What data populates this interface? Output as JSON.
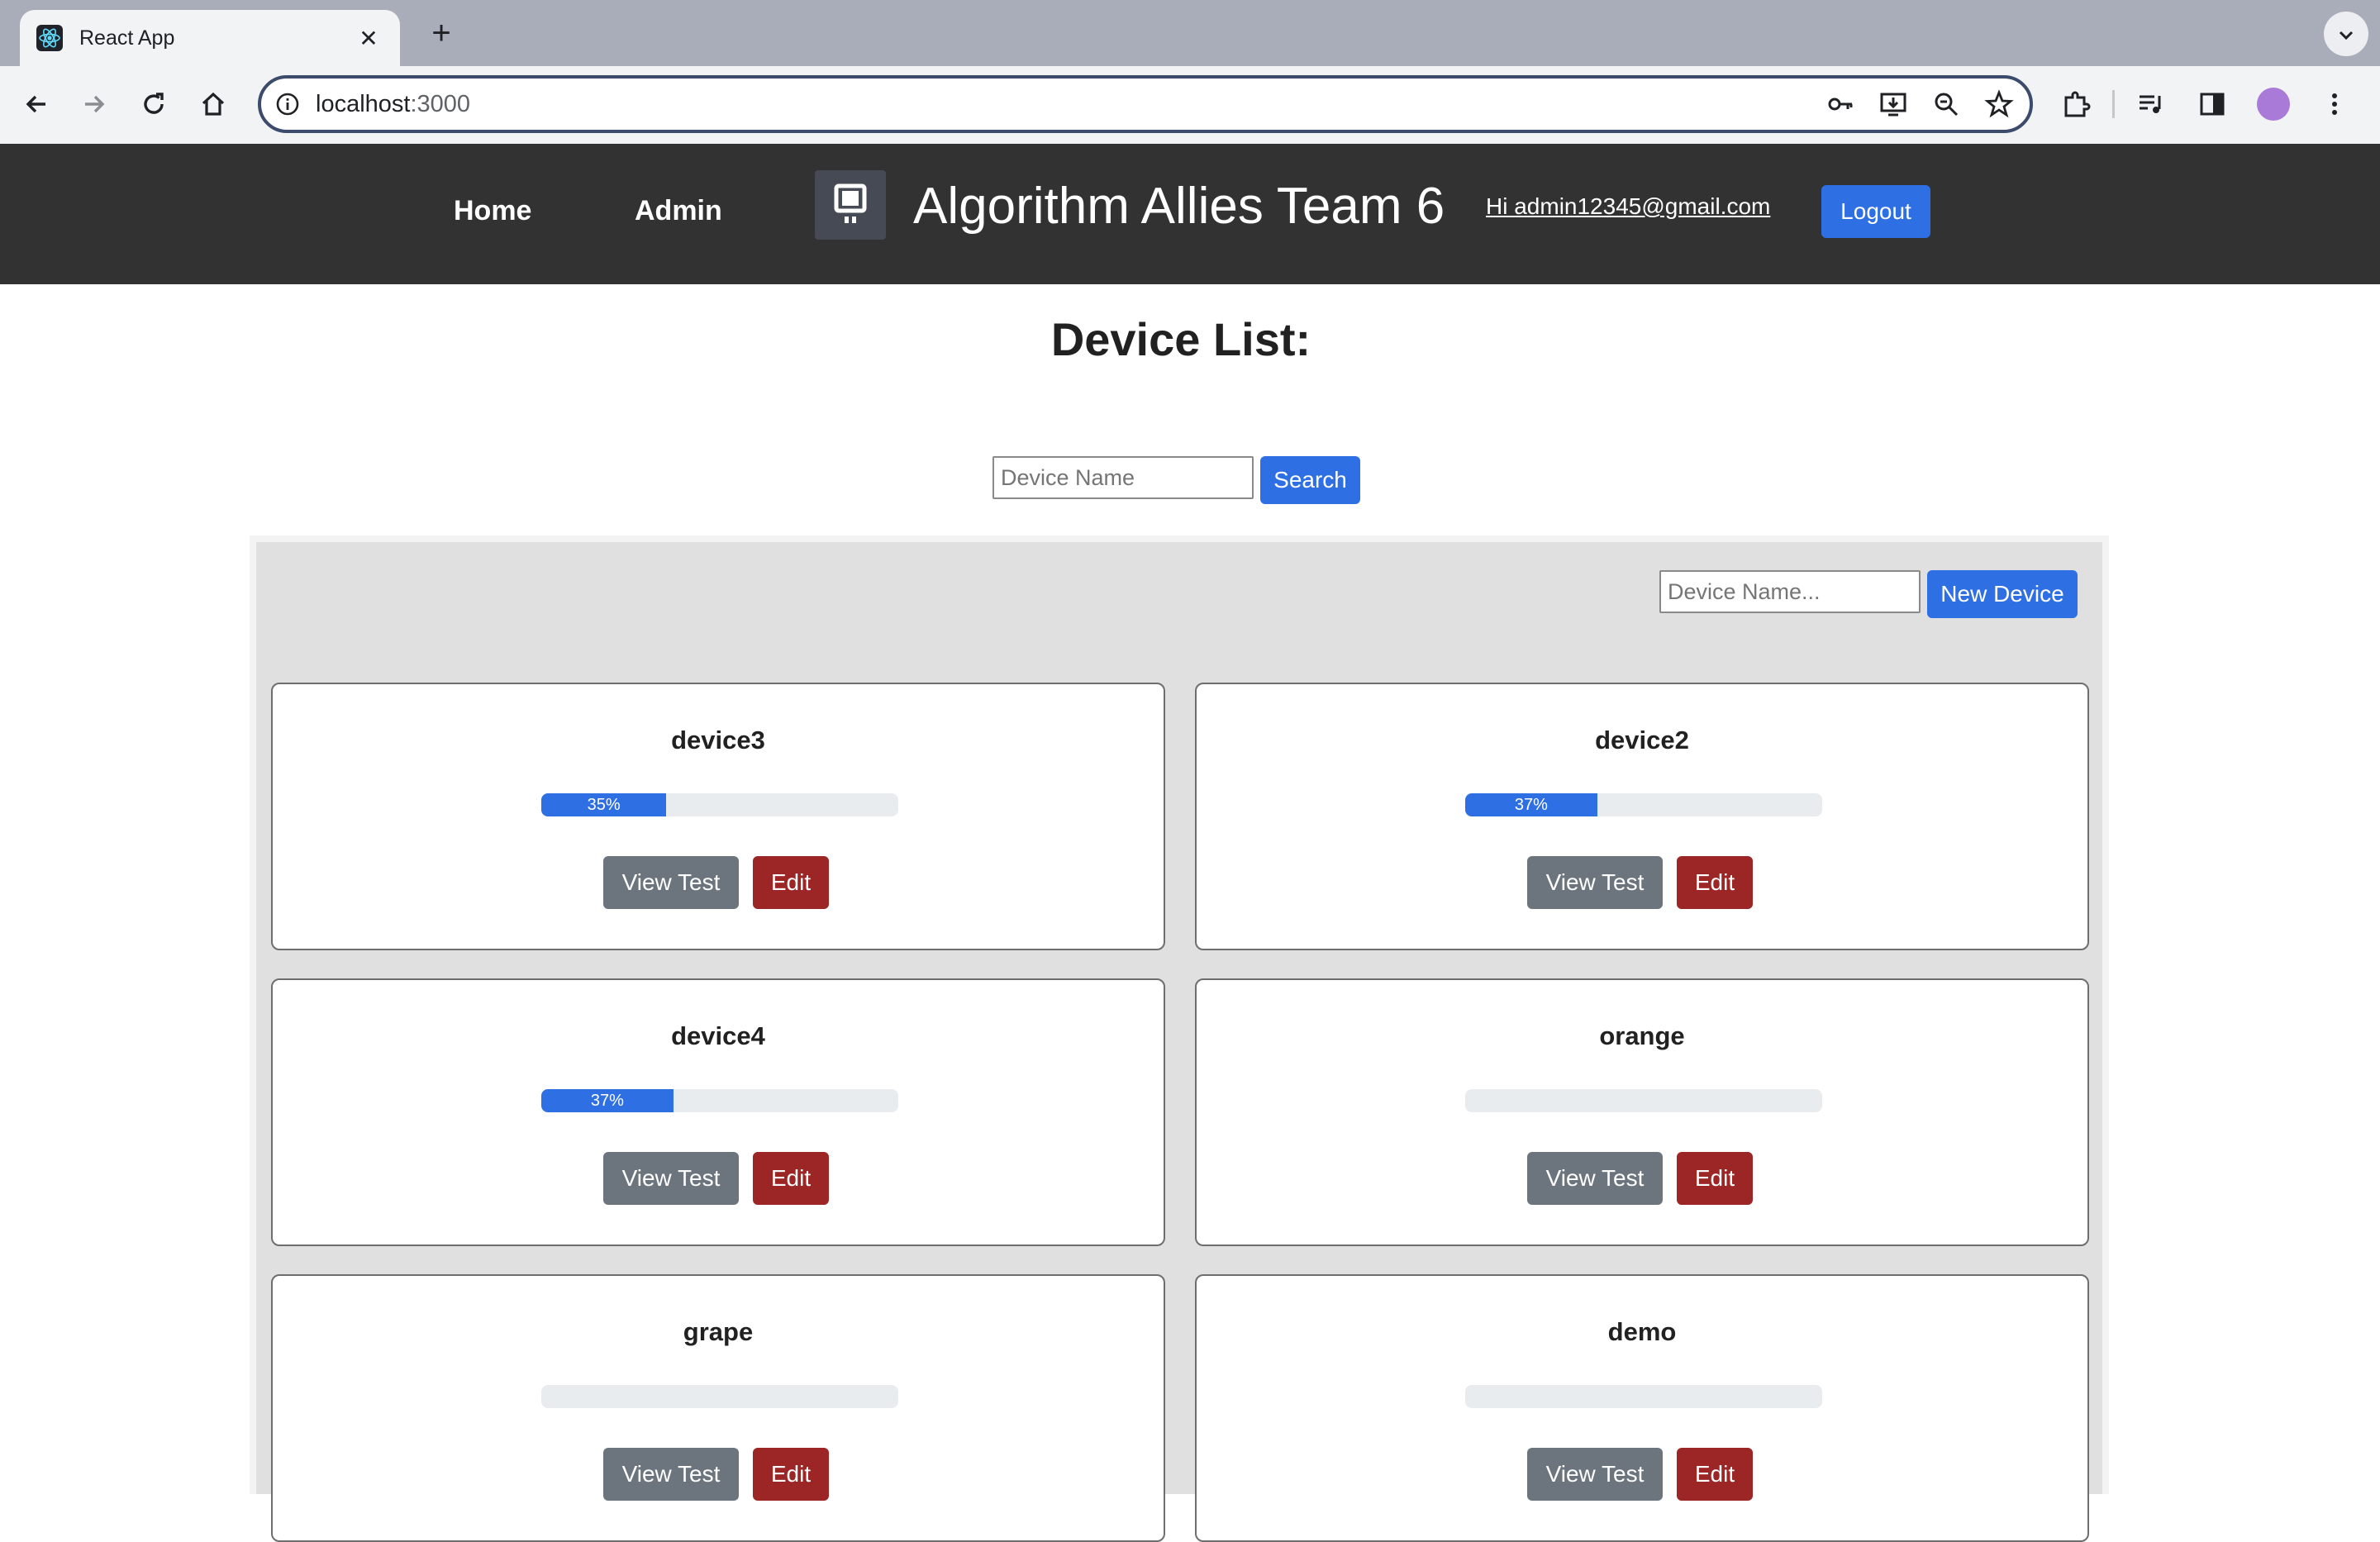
{
  "browser": {
    "tab_title": "React App",
    "new_tab_symbol": "+",
    "url_host": "localhost",
    "url_port": ":3000"
  },
  "header": {
    "nav_home": "Home",
    "nav_admin": "Admin",
    "brand": "Algorithm Allies Team 6",
    "greeting": "Hi admin12345@gmail.com",
    "logout_label": "Logout"
  },
  "main": {
    "title": "Device List:",
    "search_placeholder": "Device Name",
    "search_label": "Search",
    "new_device_placeholder": "Device Name...",
    "new_device_label": "New Device",
    "view_test_label": "View Test",
    "edit_label": "Edit",
    "devices": [
      {
        "name": "device3",
        "progress": 35,
        "progress_label": "35%"
      },
      {
        "name": "device2",
        "progress": 37,
        "progress_label": "37%"
      },
      {
        "name": "device4",
        "progress": 37,
        "progress_label": "37%"
      },
      {
        "name": "orange",
        "progress": 0,
        "progress_label": ""
      },
      {
        "name": "grape",
        "progress": 0,
        "progress_label": ""
      },
      {
        "name": "demo",
        "progress": 0,
        "progress_label": ""
      }
    ]
  },
  "colors": {
    "primary": "#2f6fe4",
    "secondary": "#6c757d",
    "danger": "#9c2525",
    "header_bg": "#323232"
  }
}
